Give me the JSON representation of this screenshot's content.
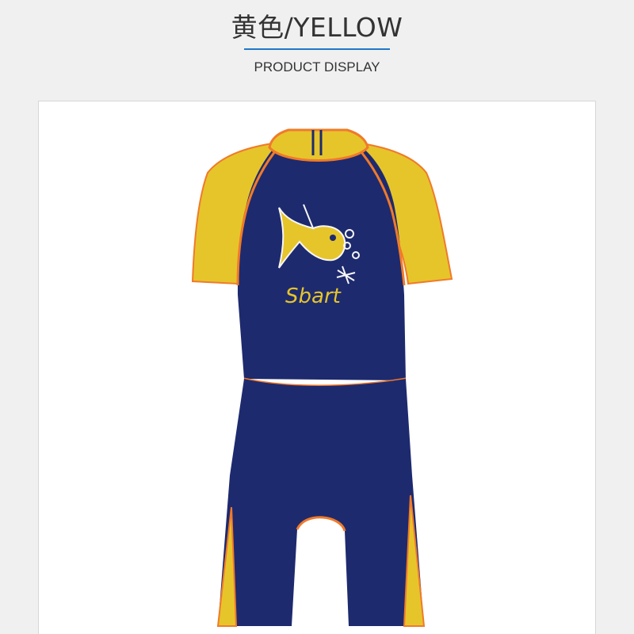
{
  "header": {
    "title": "黄色/YELLOW",
    "subtitle": "PRODUCT DISPLAY"
  },
  "product": {
    "print_text": "Sbart"
  },
  "colors": {
    "background": "#f0f0f0",
    "accent_rule": "#1f78c8",
    "navy": "#1e2a6e",
    "yellow": "#e6c52b",
    "orange_trim": "#f07a2a"
  }
}
